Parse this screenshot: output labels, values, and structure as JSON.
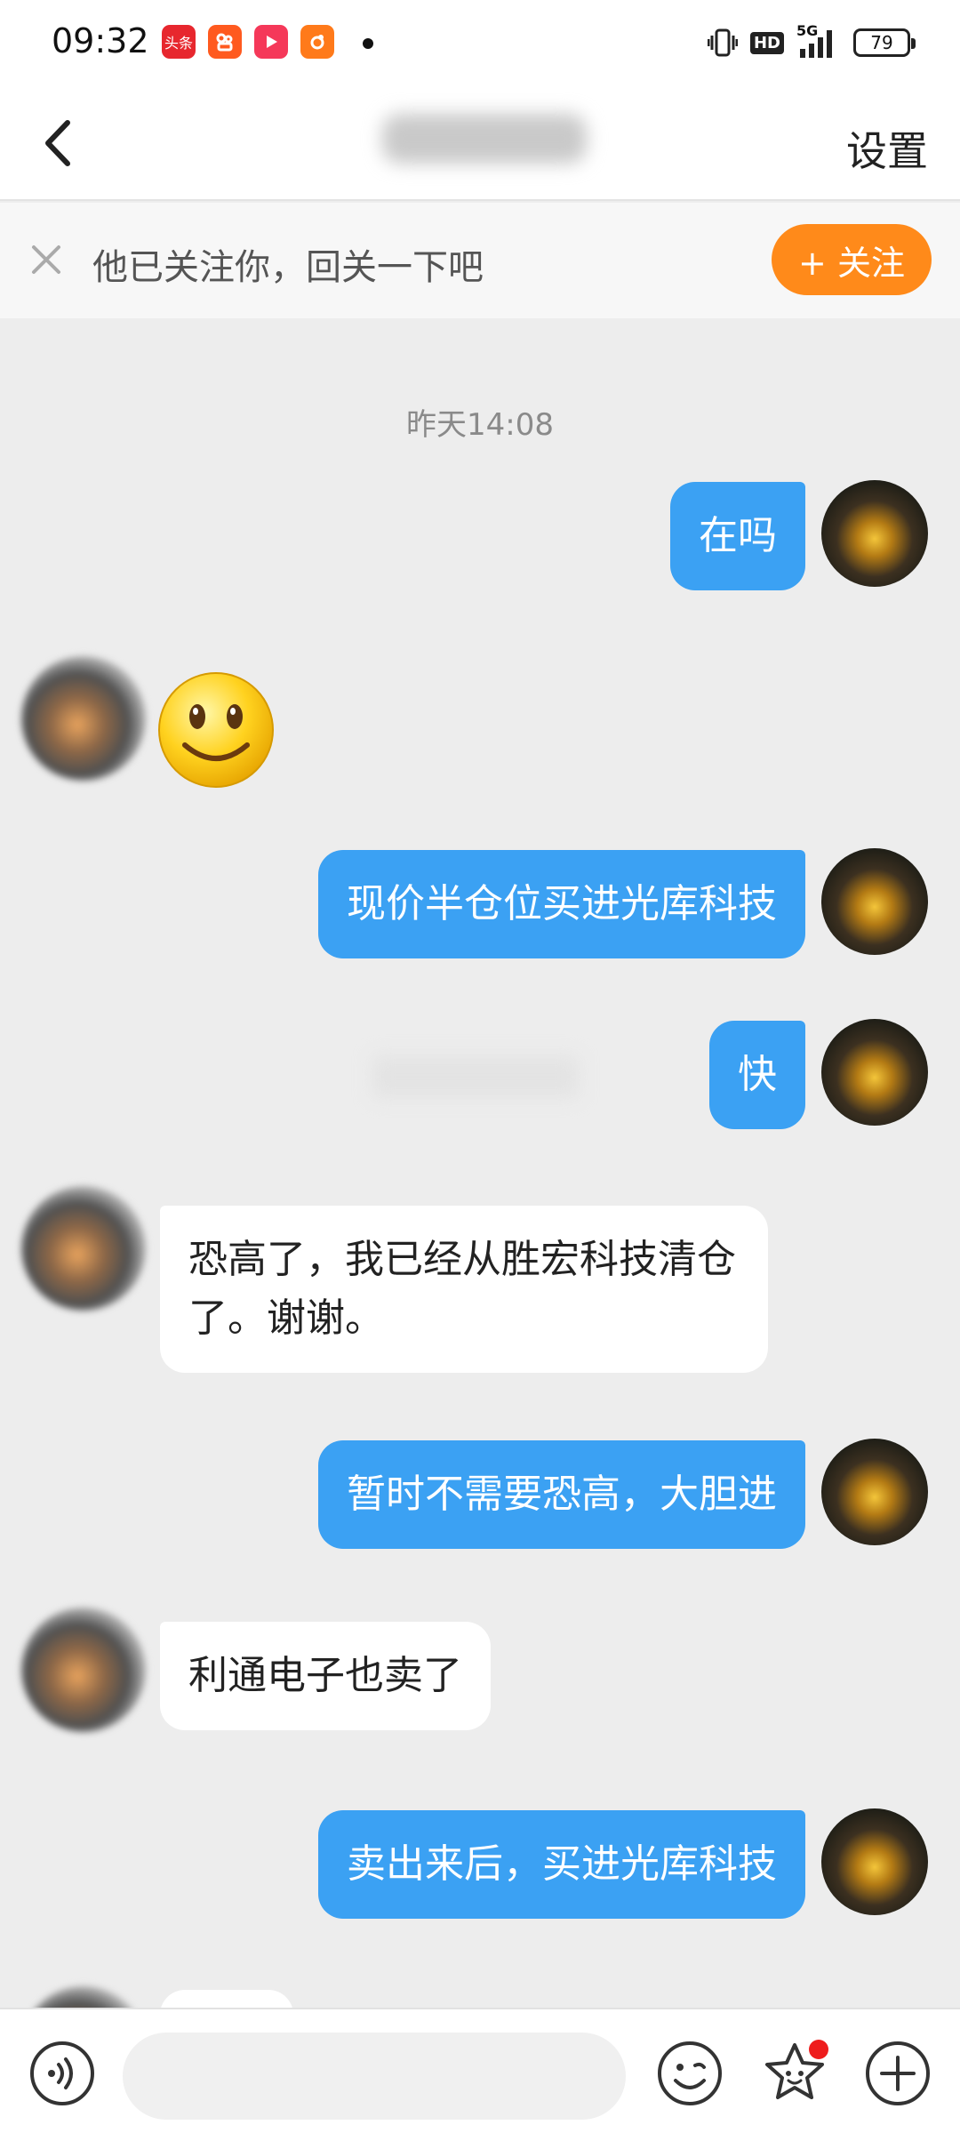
{
  "status_bar": {
    "time": "09:32",
    "apps": [
      {
        "icon": "toutiao-app-icon",
        "label": "头条",
        "color": "#e7272e"
      },
      {
        "icon": "kuaishou-app-icon",
        "label": "",
        "color": "#ff5a1f"
      },
      {
        "icon": "video-app-icon",
        "label": "",
        "color": "#f53859"
      },
      {
        "icon": "orange-app-icon",
        "label": "",
        "color": "#ff7a1a"
      }
    ],
    "network": "5G",
    "hd_label": "HD",
    "battery": "79"
  },
  "header": {
    "back_icon": "chevron-left-icon",
    "settings_label": "设置"
  },
  "follow_bar": {
    "message": "他已关注你，回关一下吧",
    "button_label": "+ 关注",
    "close_icon": "close-icon"
  },
  "chat": {
    "timestamp": "昨天14:08",
    "messages": [
      {
        "from": "me",
        "text": "在吗"
      },
      {
        "from": "other",
        "type": "emoji",
        "emoji": "smile-emoji"
      },
      {
        "from": "me",
        "text": "现价半仓位买进光库科技"
      },
      {
        "from": "me",
        "text": "快"
      },
      {
        "from": "other",
        "text": "恐高了，我已经从胜宏科技清仓了。谢谢。"
      },
      {
        "from": "me",
        "text": "暂时不需要恐高，大胆进"
      },
      {
        "from": "other",
        "text": "利通电子也卖了"
      },
      {
        "from": "me",
        "text": "卖出来后，买进光库科技"
      }
    ]
  },
  "bottom_bar": {
    "voice_icon": "voice-icon",
    "input_placeholder": "",
    "emoji_icon": "emoji-icon",
    "sticker_icon": "sticker-icon",
    "plus_icon": "plus-icon"
  },
  "colors": {
    "accent_blue": "#3ba1f3",
    "follow_orange": "#ff8a1a",
    "background": "#ededed"
  }
}
